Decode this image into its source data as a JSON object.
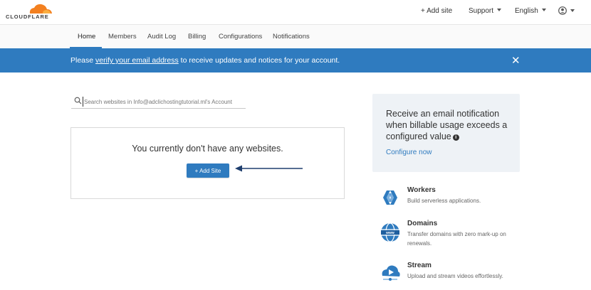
{
  "header": {
    "logo_text": "CLOUDFLARE",
    "add_site": "+ Add site",
    "support": "Support",
    "language": "English"
  },
  "nav": {
    "tabs": [
      {
        "label": "Home",
        "active": true
      },
      {
        "label": "Members"
      },
      {
        "label": "Audit Log"
      },
      {
        "label": "Billing"
      },
      {
        "label": "Configurations"
      },
      {
        "label": "Notifications"
      }
    ]
  },
  "banner": {
    "prefix": "Please ",
    "link": "verify your email address",
    "suffix": " to receive updates and notices for your account.",
    "close": "✕"
  },
  "search": {
    "placeholder": "Search websites in Info@adclichostingtutorial.ml's Account"
  },
  "empty_state": {
    "title": "You currently don't have any websites.",
    "button": "+ Add Site"
  },
  "notify": {
    "title": "Receive an email notification when billable usage exceeds a configured value",
    "info": "i",
    "link": "Configure now"
  },
  "products": [
    {
      "name": "Workers",
      "desc": "Build serverless applications.",
      "icon": "workers-icon"
    },
    {
      "name": "Domains",
      "desc": "Transfer domains with zero mark-up on renewals.",
      "icon": "domains-icon"
    },
    {
      "name": "Stream",
      "desc": "Upload and stream videos effortlessly.",
      "icon": "stream-icon"
    }
  ],
  "colors": {
    "accent": "#2f7bbf",
    "cloud_orange": "#f38020",
    "panel_bg": "#eef2f6"
  }
}
